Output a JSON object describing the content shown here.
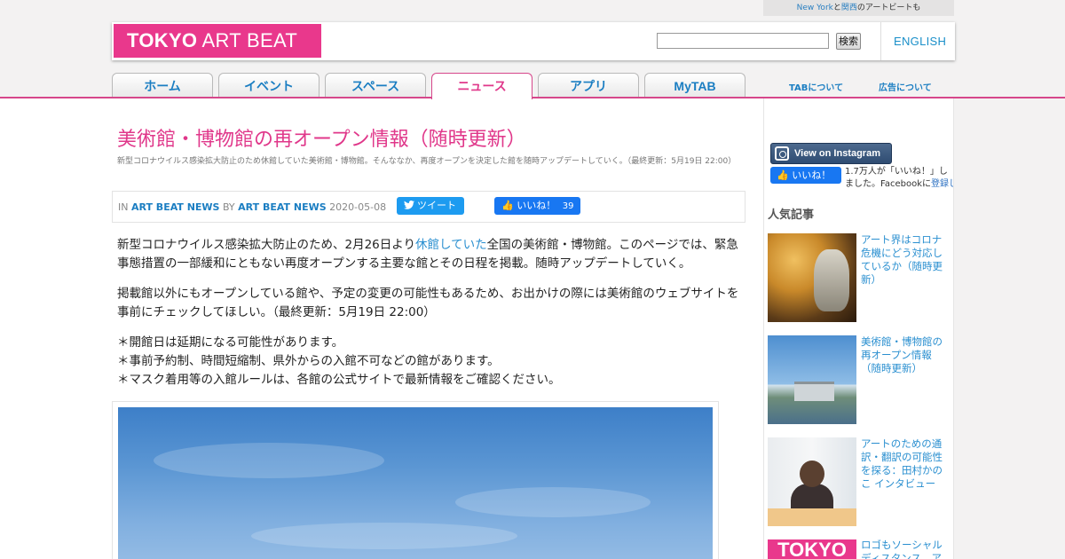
{
  "topstrip": {
    "link1": "New York",
    "sep": "と",
    "link2": "関西",
    "suffix": "のアートビートも"
  },
  "header": {
    "logo_bold": "TOKYO",
    "logo_light": " ART BEAT",
    "search_value": "",
    "search_button": "検索",
    "english": "ENGLISH"
  },
  "nav": {
    "tabs": [
      {
        "label": "ホーム"
      },
      {
        "label": "イベント"
      },
      {
        "label": "スペース"
      },
      {
        "label": "ニュース"
      },
      {
        "label": "アプリ"
      },
      {
        "label": "MyTAB"
      }
    ],
    "active_tab": "ニュース",
    "sub_links": [
      "TABについて",
      "広告について"
    ]
  },
  "article": {
    "title": "美術館・博物館の再オープン情報（随時更新）",
    "lead": "新型コロナウイルス感染拡大防止のため休館していた美術館・博物館。そんななか、再度オープンを決定した館を随時アップデートしていく。（最終更新：5月19日 22:00）",
    "meta": {
      "in_label": "IN",
      "category": "ART BEAT NEWS",
      "by_label": "BY",
      "author": "ART BEAT NEWS",
      "date": "2020-05-08"
    },
    "tweet_label": "ツイート",
    "fb_like_label": "いいね！",
    "fb_like_count": "39",
    "para1_a": "新型コロナウイルス感染拡大防止のため、2月26日より",
    "para1_link": "休館していた",
    "para1_b": "全国の美術館・博物館。このページでは、緊急事態措置の一部緩和にともない再度オープンする主要な館とその日程を掲載。随時アップデートしていく。",
    "para2": "掲載館以外にもオープンしている館や、予定の変更の可能性もあるため、お出かけの際には美術館のウェブサイトを事前にチェックしてほしい。（最終更新：5月19日 22:00）",
    "notes": [
      "＊開館日は延期になる可能性があります。",
      "＊事前予約制、時間短縮制、県外からの入館不可などの館があります。",
      "＊マスク着用等の入館ルールは、各館の公式サイトで最新情報をご確認ください。"
    ]
  },
  "sidebar": {
    "instagram_label": "View on Instagram",
    "fb_like_label": "いいね！",
    "fb_text_line1": "1.7万人が「いいね！」し",
    "fb_text_line2_a": "ました。Facebookに",
    "fb_text_line2_link": "登録し",
    "popular_heading": "人気記事",
    "popular": [
      {
        "title": "アート界はコロナ危機にどう対応しているか（随時更新）"
      },
      {
        "title": "美術館・博物館の再オープン情報（随時更新）"
      },
      {
        "title": "アートのための通訳・翻訳の可能性を探る：田村かのこ インタビュー"
      },
      {
        "title": "ロゴもソーシャルディスタンス…ア",
        "thumb_text": "TOKYO"
      }
    ]
  },
  "colors": {
    "brand_pink": "#e9388c",
    "link_blue": "#1b7ec2",
    "twitter": "#1d9bf0",
    "facebook": "#1877f2"
  }
}
